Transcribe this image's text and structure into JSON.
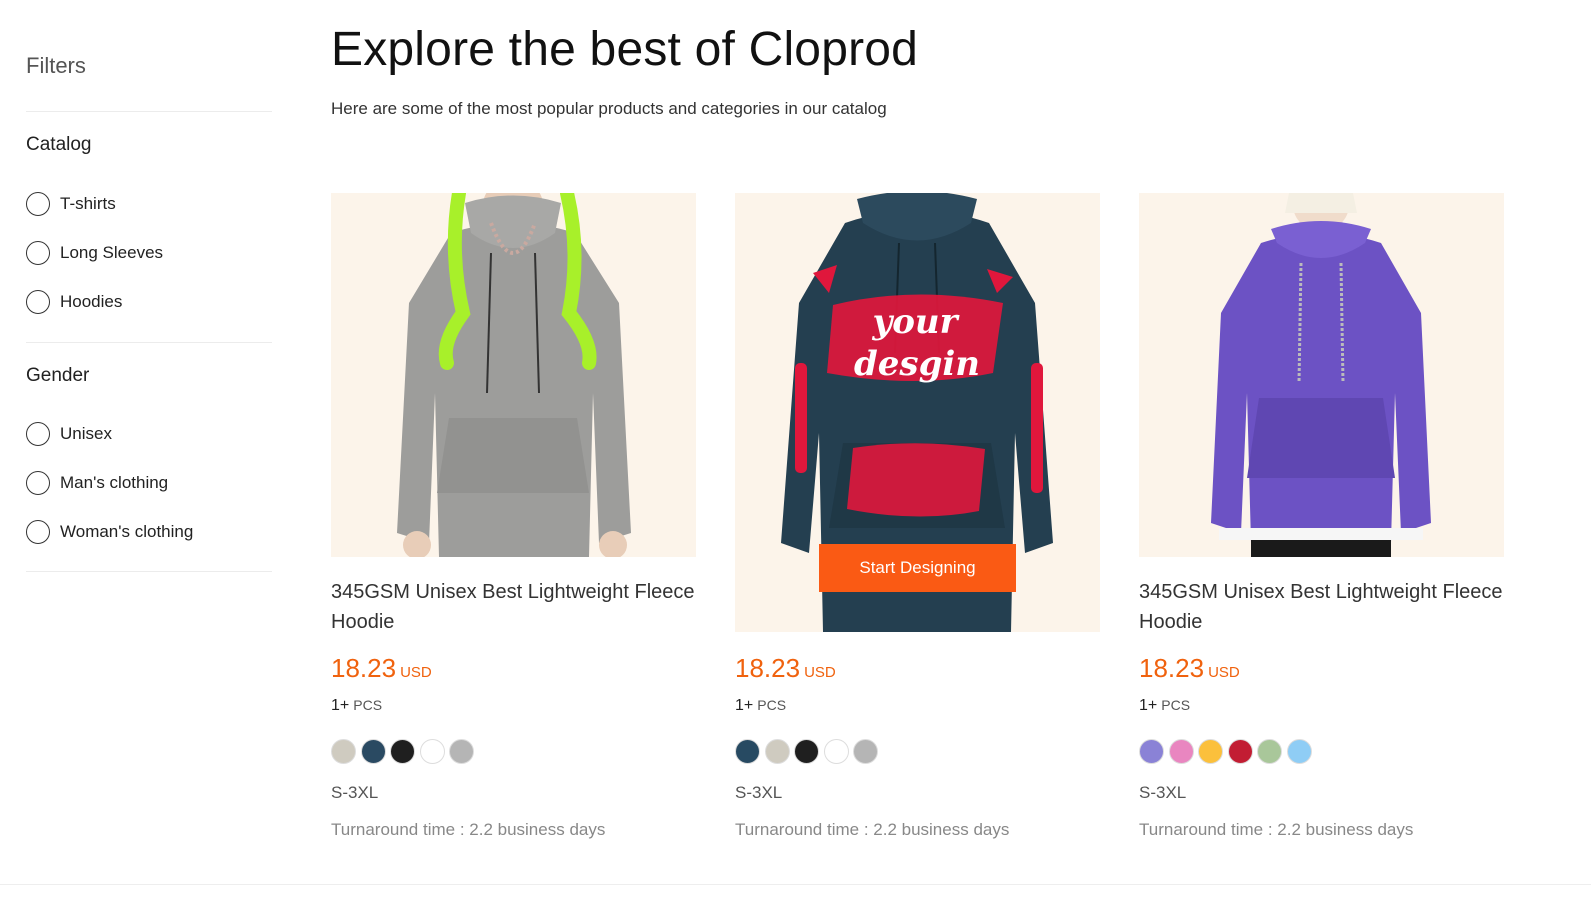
{
  "sidebar": {
    "title": "Filters",
    "catalog": {
      "title": "Catalog",
      "options": [
        "T-shirts",
        "Long Sleeves",
        "Hoodies"
      ]
    },
    "gender": {
      "title": "Gender",
      "options": [
        "Unisex",
        "Man's clothing",
        "Woman's clothing"
      ]
    }
  },
  "main": {
    "title": "Explore the best of Cloprod",
    "subtitle": "Here are some of the most popular products and categories in our catalog"
  },
  "products": [
    {
      "name": "345GSM Unisex Best Lightweight Fleece Hoodie",
      "price": "18.23",
      "currency": "USD",
      "moq": "1+",
      "moq_unit": "PCS",
      "sizes": "S-3XL",
      "turnaround": "Turnaround time : 2.2 business days",
      "hoodie_color": "#9d9d9b",
      "colors": [
        "#cfcbc0",
        "#2a4a62",
        "#1f1f1f",
        "#ffffff",
        "#b5b5b5"
      ]
    },
    {
      "name": "",
      "price": "18.23",
      "currency": "USD",
      "moq": "1+",
      "moq_unit": "PCS",
      "sizes": "S-3XL",
      "turnaround": "Turnaround time : 2.2 business days",
      "overlay_button": "Start Designing",
      "design_text_1": "your",
      "design_text_2": "desgin",
      "hoodie_color": "#243f50",
      "colors": [
        "#274a62",
        "#cfcbc0",
        "#1f1f1f",
        "#ffffff",
        "#b5b5b5"
      ]
    },
    {
      "name": "345GSM Unisex Best Lightweight Fleece Hoodie",
      "price": "18.23",
      "currency": "USD",
      "moq": "1+",
      "moq_unit": "PCS",
      "sizes": "S-3XL",
      "turnaround": "Turnaround time : 2.2 business days",
      "hoodie_color": "#6c52c4",
      "colors": [
        "#8a82d6",
        "#e986c0",
        "#fbc03c",
        "#c21d33",
        "#a9c79a",
        "#8fcdf5"
      ]
    }
  ],
  "colors": {
    "accent": "#fa5a14",
    "price": "#f0620e",
    "image_bg": "#fcf4ea"
  }
}
